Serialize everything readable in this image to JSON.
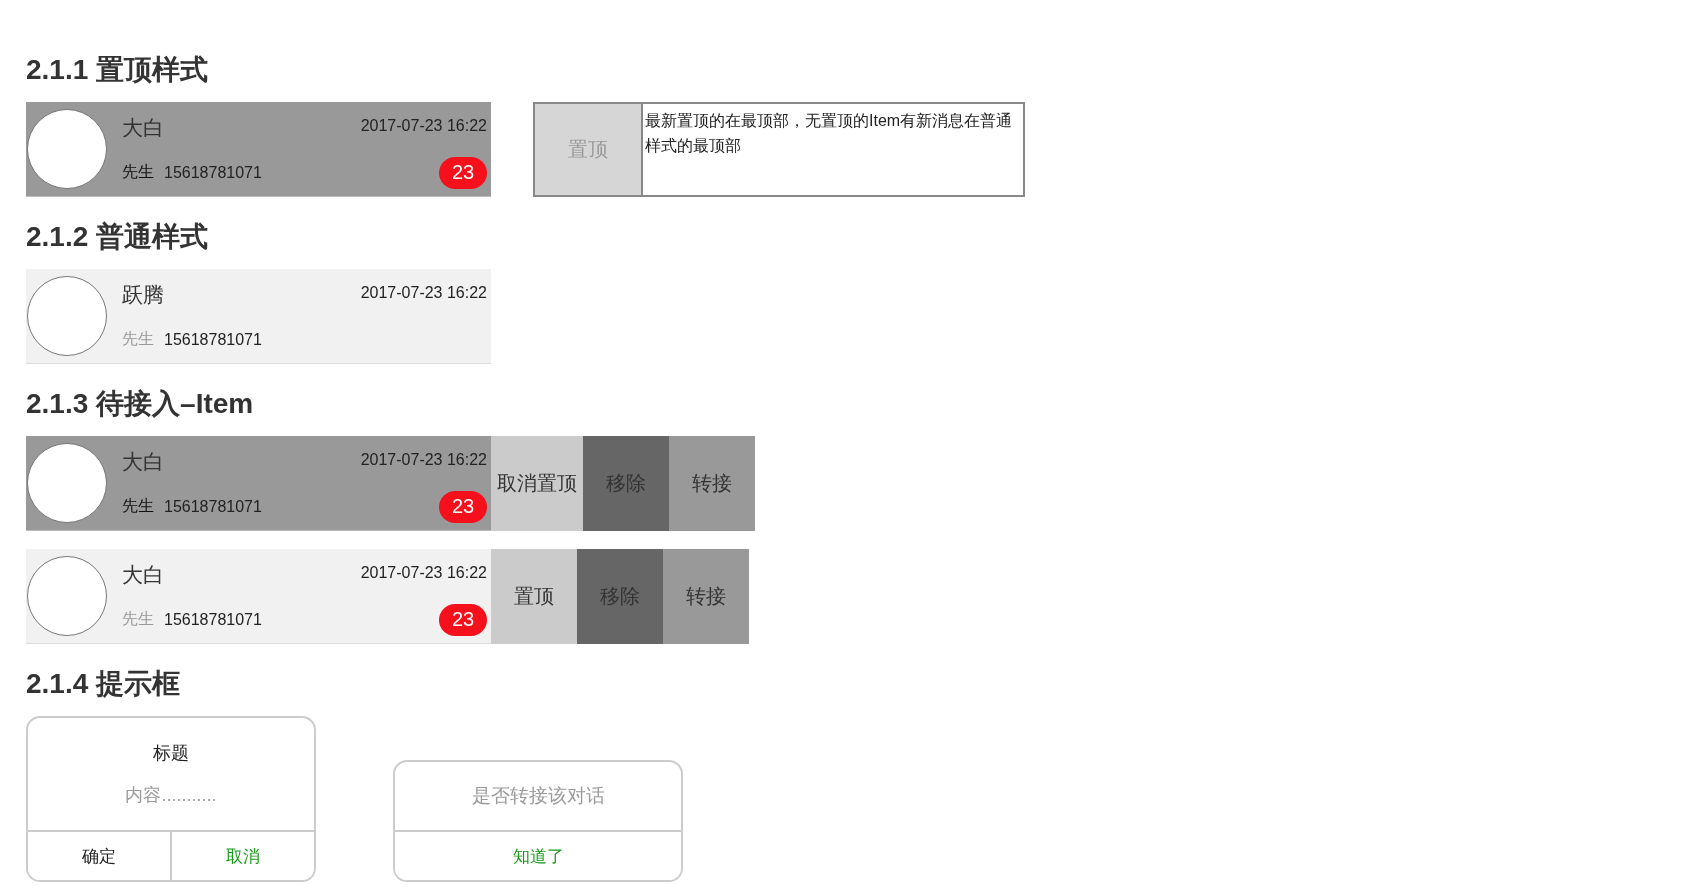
{
  "sections": [
    {
      "kind": "pinned-demo",
      "title": "2.1.1 置顶样式",
      "item": {
        "name": "大白",
        "pinned": true,
        "salutation": "先生",
        "phone": "15618781071",
        "time": "2017-07-23 16:22",
        "badge": "23"
      },
      "note": {
        "label": "置顶",
        "text": "最新置顶的在最顶部，无置顶的Item有新消息在普通样式的最顶部"
      }
    },
    {
      "kind": "list",
      "title": "2.1.2 普通样式",
      "items": [
        {
          "name": "跃腾",
          "pinned": false,
          "salutation": "先生",
          "phone": "15618781071",
          "time": "2017-07-23 16:22"
        }
      ]
    },
    {
      "kind": "swipe",
      "title": "2.1.3 待接入–Item",
      "rows": [
        {
          "item": {
            "name": "大白",
            "pinned": true,
            "salutation": "先生",
            "phone": "15618781071",
            "time": "2017-07-23 16:22",
            "badge": "23"
          },
          "actions": [
            {
              "label": "取消置顶",
              "kind": "light"
            },
            {
              "label": "移除",
              "kind": "dark"
            },
            {
              "label": "转接",
              "kind": "medium"
            }
          ]
        },
        {
          "item": {
            "name": "大白",
            "pinned": false,
            "salutation": "先生",
            "phone": "15618781071",
            "time": "2017-07-23 16:22",
            "badge": "23"
          },
          "actions": [
            {
              "label": "置顶",
              "kind": "light"
            },
            {
              "label": "移除",
              "kind": "dark"
            },
            {
              "label": "转接",
              "kind": "medium"
            }
          ]
        }
      ]
    },
    {
      "kind": "dialogs",
      "title": "2.1.4 提示框",
      "dialogs": [
        {
          "title": "标题",
          "content": "内容...........",
          "buttons": [
            {
              "label": "确定",
              "kind": "default"
            },
            {
              "label": "取消",
              "kind": "primary"
            }
          ]
        },
        {
          "content": "是否转接该对话",
          "buttons": [
            {
              "label": "知道了",
              "kind": "primary"
            }
          ]
        }
      ]
    }
  ]
}
